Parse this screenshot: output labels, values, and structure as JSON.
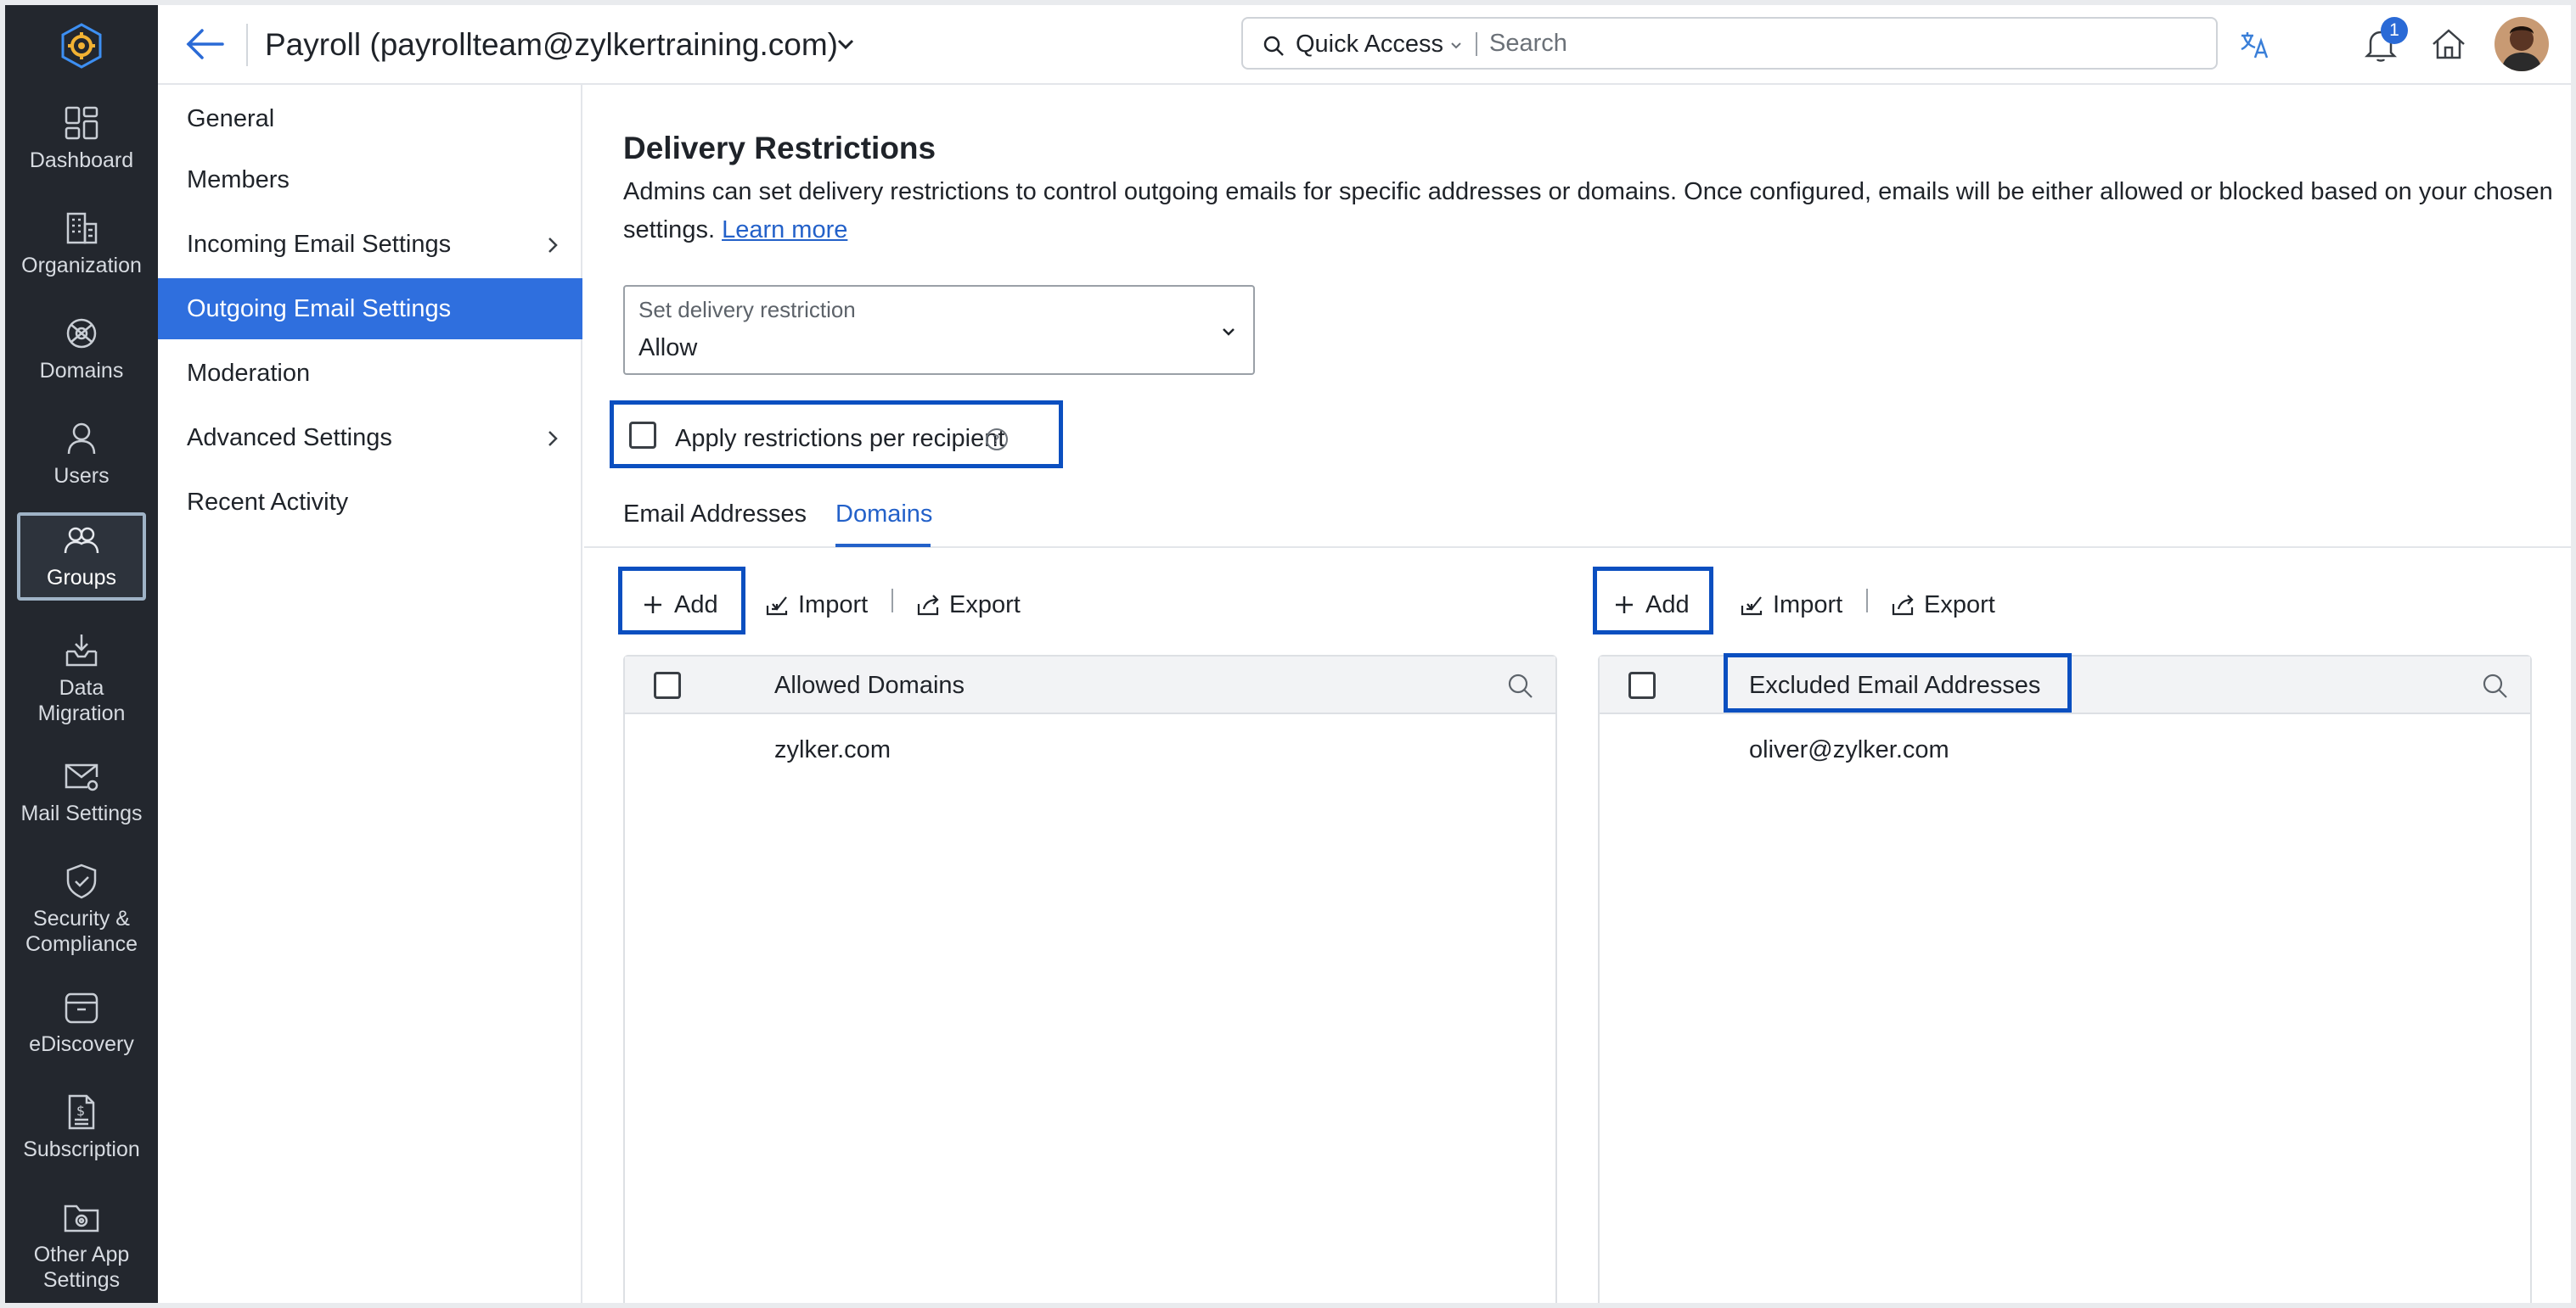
{
  "app": {
    "title": "Payroll (payrollteam@zylkertraining.com)"
  },
  "search": {
    "quick_access": "Quick Access",
    "placeholder": "Search"
  },
  "notifications": {
    "count": "1"
  },
  "rail": {
    "items": [
      {
        "lines": [
          "Dashboard"
        ]
      },
      {
        "lines": [
          "Organization"
        ]
      },
      {
        "lines": [
          "Domains"
        ]
      },
      {
        "lines": [
          "Users"
        ]
      },
      {
        "lines": [
          "Groups"
        ]
      },
      {
        "lines": [
          "Data",
          "Migration"
        ]
      },
      {
        "lines": [
          "Mail Settings"
        ]
      },
      {
        "lines": [
          "Security &",
          "Compliance"
        ]
      },
      {
        "lines": [
          "eDiscovery"
        ]
      },
      {
        "lines": [
          "Subscription"
        ]
      },
      {
        "lines": [
          "Other App",
          "Settings"
        ]
      }
    ]
  },
  "subnav": {
    "items": [
      {
        "label": "General"
      },
      {
        "label": "Members"
      },
      {
        "label": "Incoming Email Settings"
      },
      {
        "label": "Outgoing Email Settings"
      },
      {
        "label": "Moderation"
      },
      {
        "label": "Advanced Settings"
      },
      {
        "label": "Recent Activity"
      }
    ]
  },
  "main": {
    "title": "Delivery Restrictions",
    "description": "Admins can set delivery restrictions to control outgoing emails for specific addresses or domains. Once configured, emails will be either allowed or blocked based on your chosen settings.",
    "learn_more": "Learn more",
    "restriction": {
      "label": "Set delivery restriction",
      "value": "Allow"
    },
    "apply_per_recipient": "Apply restrictions per recipient",
    "tabs": [
      {
        "label": "Email Addresses"
      },
      {
        "label": "Domains"
      }
    ],
    "toolbar": {
      "add": "Add",
      "import": "Import",
      "export": "Export"
    },
    "allowed_panel": {
      "header": "Allowed Domains",
      "rows": [
        "zylker.com"
      ]
    },
    "excluded_panel": {
      "header": "Excluded Email Addresses",
      "rows": [
        "oliver@zylker.com"
      ]
    }
  },
  "colors": {
    "rail_bg": "#23272e",
    "accent": "#2f6fde",
    "highlight_border": "#0b4fc0",
    "link": "#2361c9"
  }
}
